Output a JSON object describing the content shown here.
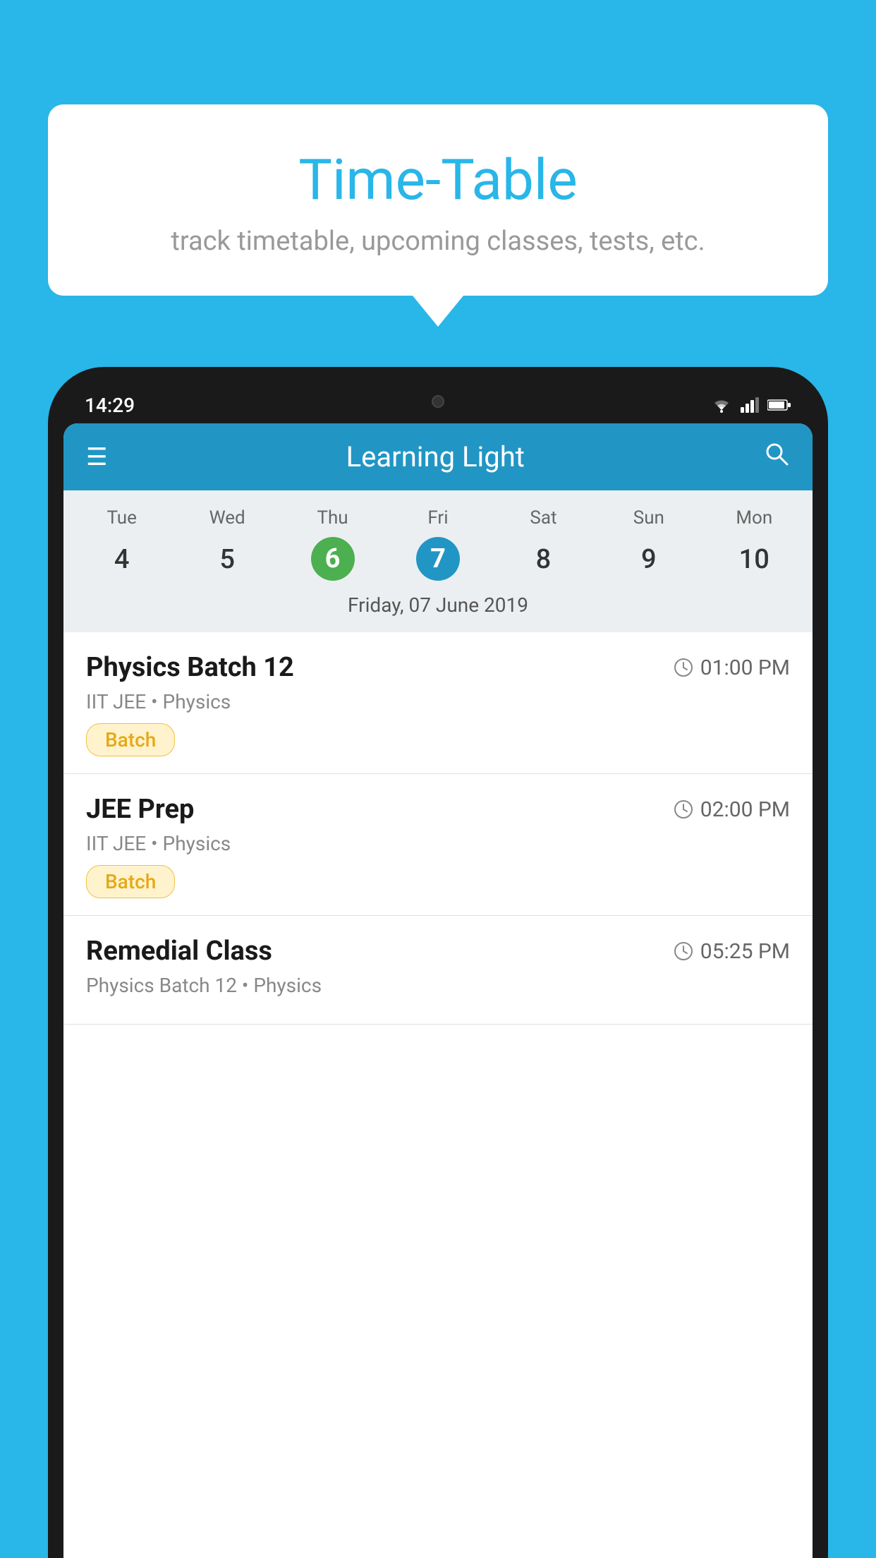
{
  "background_color": "#29b6e8",
  "tooltip": {
    "title": "Time-Table",
    "subtitle": "track timetable, upcoming classes, tests, etc."
  },
  "phone": {
    "status_bar": {
      "time": "14:29",
      "icons": [
        "wifi",
        "signal",
        "battery"
      ]
    },
    "app_header": {
      "title": "Learning Light",
      "menu_icon": "☰",
      "search_icon": "🔍"
    },
    "calendar": {
      "days": [
        "Tue",
        "Wed",
        "Thu",
        "Fri",
        "Sat",
        "Sun",
        "Mon"
      ],
      "dates": [
        "4",
        "5",
        "6",
        "7",
        "8",
        "9",
        "10"
      ],
      "today_index": 2,
      "selected_index": 3,
      "selected_date_label": "Friday, 07 June 2019"
    },
    "schedule": [
      {
        "title": "Physics Batch 12",
        "time": "01:00 PM",
        "meta": "IIT JEE • Physics",
        "badge": "Batch"
      },
      {
        "title": "JEE Prep",
        "time": "02:00 PM",
        "meta": "IIT JEE • Physics",
        "badge": "Batch"
      },
      {
        "title": "Remedial Class",
        "time": "05:25 PM",
        "meta": "Physics Batch 12 • Physics",
        "badge": ""
      }
    ]
  }
}
